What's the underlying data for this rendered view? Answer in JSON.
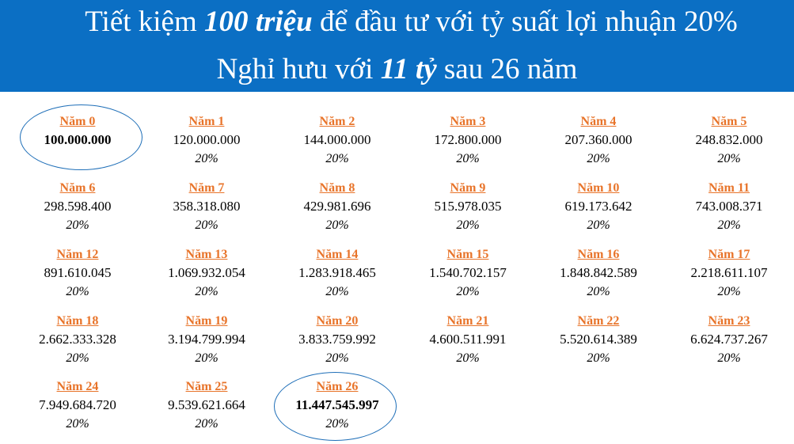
{
  "banner": {
    "line1_pre": "Tiết kiệm ",
    "line1_bold": "100 triệu",
    "line1_post": " để đầu tư với tỷ suất lợi nhuận 20%",
    "line2_pre": "Nghỉ hưu với ",
    "line2_bold": "11 tỷ",
    "line2_post": " sau 26 năm"
  },
  "years": [
    {
      "label": "Năm 0",
      "amount": "100.000.000",
      "rate": ""
    },
    {
      "label": "Năm 1",
      "amount": "120.000.000",
      "rate": "20%"
    },
    {
      "label": "Năm 2",
      "amount": "144.000.000",
      "rate": "20%"
    },
    {
      "label": "Năm 3",
      "amount": "172.800.000",
      "rate": "20%"
    },
    {
      "label": "Năm 4",
      "amount": "207.360.000",
      "rate": "20%"
    },
    {
      "label": "Năm 5",
      "amount": "248.832.000",
      "rate": "20%"
    },
    {
      "label": "Năm 6",
      "amount": "298.598.400",
      "rate": "20%"
    },
    {
      "label": "Năm 7",
      "amount": "358.318.080",
      "rate": "20%"
    },
    {
      "label": "Năm 8",
      "amount": "429.981.696",
      "rate": "20%"
    },
    {
      "label": "Năm 9",
      "amount": "515.978.035",
      "rate": "20%"
    },
    {
      "label": "Năm 10",
      "amount": "619.173.642",
      "rate": "20%"
    },
    {
      "label": "Năm 11",
      "amount": "743.008.371",
      "rate": "20%"
    },
    {
      "label": "Năm 12",
      "amount": "891.610.045",
      "rate": "20%"
    },
    {
      "label": "Năm 13",
      "amount": "1.069.932.054",
      "rate": "20%"
    },
    {
      "label": "Năm 14",
      "amount": "1.283.918.465",
      "rate": "20%"
    },
    {
      "label": "Năm 15",
      "amount": "1.540.702.157",
      "rate": "20%"
    },
    {
      "label": "Năm 16",
      "amount": "1.848.842.589",
      "rate": "20%"
    },
    {
      "label": "Năm 17",
      "amount": "2.218.611.107",
      "rate": "20%"
    },
    {
      "label": "Năm 18",
      "amount": "2.662.333.328",
      "rate": "20%"
    },
    {
      "label": "Năm 19",
      "amount": "3.194.799.994",
      "rate": "20%"
    },
    {
      "label": "Năm 20",
      "amount": "3.833.759.992",
      "rate": "20%"
    },
    {
      "label": "Năm 21",
      "amount": "4.600.511.991",
      "rate": "20%"
    },
    {
      "label": "Năm 22",
      "amount": "5.520.614.389",
      "rate": "20%"
    },
    {
      "label": "Năm 23",
      "amount": "6.624.737.267",
      "rate": "20%"
    },
    {
      "label": "Năm 24",
      "amount": "7.949.684.720",
      "rate": "20%"
    },
    {
      "label": "Năm 25",
      "amount": "9.539.621.664",
      "rate": "20%"
    },
    {
      "label": "Năm 26",
      "amount": "11.447.545.997",
      "rate": "20%"
    }
  ],
  "colors": {
    "banner_bg": "#0b6fc4",
    "year_label": "#e8742a",
    "highlight_ellipse": "#1f6fb8"
  }
}
